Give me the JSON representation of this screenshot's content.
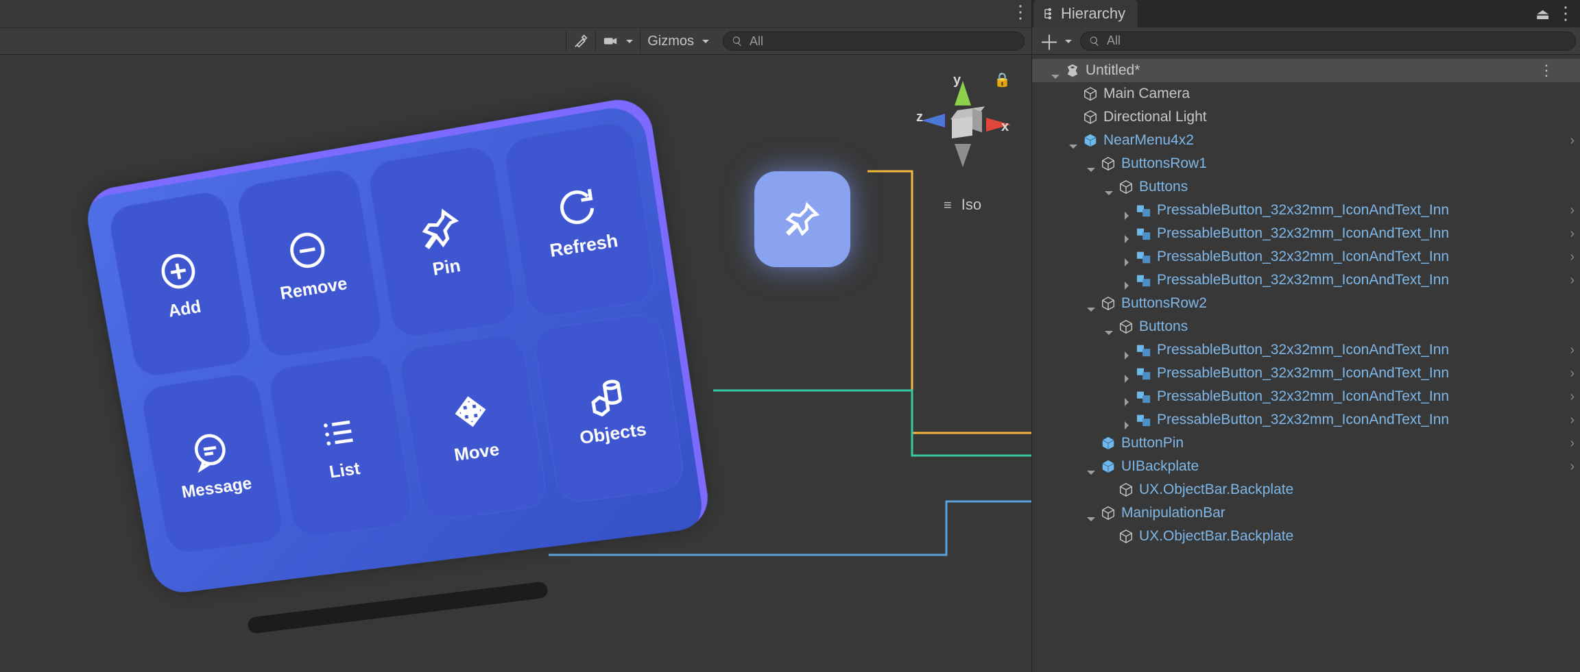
{
  "sceneToolbar": {
    "gizmosLabel": "Gizmos",
    "searchPlaceholder": "All"
  },
  "gizmo": {
    "axisX": "x",
    "axisY": "y",
    "axisZ": "z",
    "projectionLabel": "Iso"
  },
  "nearMenu": {
    "buttons": [
      {
        "label": "Add",
        "icon": "plus-circle-icon"
      },
      {
        "label": "Remove",
        "icon": "minus-circle-icon"
      },
      {
        "label": "Pin",
        "icon": "pin-icon"
      },
      {
        "label": "Refresh",
        "icon": "refresh-icon"
      },
      {
        "label": "Message",
        "icon": "message-icon"
      },
      {
        "label": "List",
        "icon": "list-icon"
      },
      {
        "label": "Move",
        "icon": "move-icon"
      },
      {
        "label": "Objects",
        "icon": "objects-icon"
      }
    ]
  },
  "hierarchy": {
    "panelTitle": "Hierarchy",
    "searchPlaceholder": "All",
    "sceneName": "Untitled*",
    "rows": [
      {
        "depth": 0,
        "foldout": "open",
        "iconType": "scene",
        "prefab": false,
        "label": "Untitled*",
        "selected": true,
        "trailingDots": true
      },
      {
        "depth": 1,
        "foldout": "none",
        "iconType": "go",
        "prefab": false,
        "label": "Main Camera"
      },
      {
        "depth": 1,
        "foldout": "none",
        "iconType": "go",
        "prefab": false,
        "label": "Directional Light"
      },
      {
        "depth": 1,
        "foldout": "open",
        "iconType": "prefab",
        "prefab": true,
        "label": "NearMenu4x2",
        "chevron": true
      },
      {
        "depth": 2,
        "foldout": "open",
        "iconType": "go",
        "prefab": true,
        "label": "ButtonsRow1"
      },
      {
        "depth": 3,
        "foldout": "open",
        "iconType": "go",
        "prefab": true,
        "label": "Buttons"
      },
      {
        "depth": 4,
        "foldout": "closed",
        "iconType": "nested",
        "prefab": true,
        "label": "PressableButton_32x32mm_IconAndText_Inn",
        "chevron": true
      },
      {
        "depth": 4,
        "foldout": "closed",
        "iconType": "nested",
        "prefab": true,
        "label": "PressableButton_32x32mm_IconAndText_Inn",
        "chevron": true
      },
      {
        "depth": 4,
        "foldout": "closed",
        "iconType": "nested",
        "prefab": true,
        "label": "PressableButton_32x32mm_IconAndText_Inn",
        "chevron": true
      },
      {
        "depth": 4,
        "foldout": "closed",
        "iconType": "nested",
        "prefab": true,
        "label": "PressableButton_32x32mm_IconAndText_Inn",
        "chevron": true
      },
      {
        "depth": 2,
        "foldout": "open",
        "iconType": "go",
        "prefab": true,
        "label": "ButtonsRow2"
      },
      {
        "depth": 3,
        "foldout": "open",
        "iconType": "go",
        "prefab": true,
        "label": "Buttons"
      },
      {
        "depth": 4,
        "foldout": "closed",
        "iconType": "nested",
        "prefab": true,
        "label": "PressableButton_32x32mm_IconAndText_Inn",
        "chevron": true
      },
      {
        "depth": 4,
        "foldout": "closed",
        "iconType": "nested",
        "prefab": true,
        "label": "PressableButton_32x32mm_IconAndText_Inn",
        "chevron": true
      },
      {
        "depth": 4,
        "foldout": "closed",
        "iconType": "nested",
        "prefab": true,
        "label": "PressableButton_32x32mm_IconAndText_Inn",
        "chevron": true
      },
      {
        "depth": 4,
        "foldout": "closed",
        "iconType": "nested",
        "prefab": true,
        "label": "PressableButton_32x32mm_IconAndText_Inn",
        "chevron": true
      },
      {
        "depth": 2,
        "foldout": "none",
        "iconType": "prefab",
        "prefab": true,
        "label": "ButtonPin",
        "chevron": true,
        "annotateColor": "#f2b93d"
      },
      {
        "depth": 2,
        "foldout": "open",
        "iconType": "prefab",
        "prefab": true,
        "label": "UIBackplate",
        "chevron": true,
        "annotateColor": "#38c9a1"
      },
      {
        "depth": 3,
        "foldout": "none",
        "iconType": "go",
        "prefab": true,
        "label": "UX.ObjectBar.Backplate"
      },
      {
        "depth": 2,
        "foldout": "open",
        "iconType": "go",
        "prefab": true,
        "label": "ManipulationBar",
        "annotateColor": "#5aa3e0"
      },
      {
        "depth": 3,
        "foldout": "none",
        "iconType": "go",
        "prefab": true,
        "label": "UX.ObjectBar.Backplate"
      }
    ]
  }
}
